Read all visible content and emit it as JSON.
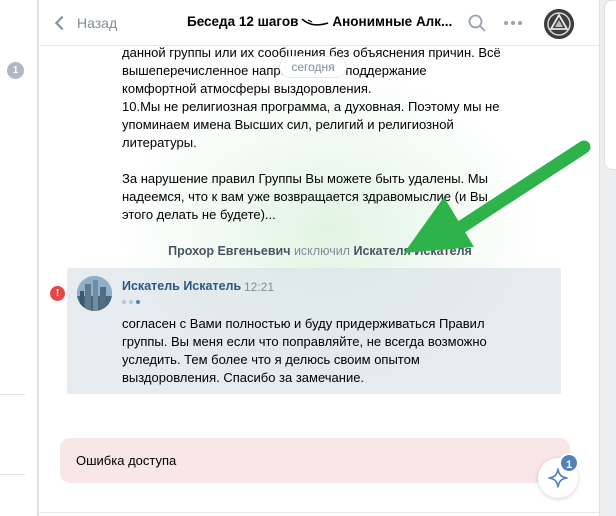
{
  "left": {
    "badge": "1"
  },
  "header": {
    "back_label": "Назад",
    "title_part1": "Беседа 12 шагов",
    "title_part2": "Анонимные Алк..."
  },
  "date_pill": "сегодня",
  "prev_message_lines": [
    "данной группы или их сообщения без объяснения причин. Всё",
    "вышеперечисленное направлено на поддержание",
    "комфортной атмосферы выздоровления.",
    "10.Мы не религиозная программа, а духовная. Поэтому мы не",
    "упоминаем имена Высших сил, религий и религиозной",
    "литературы.",
    "За нарушение правил Группы Вы можете быть удалены. Мы",
    "надеемся, что к вам уже возвращается здравомыслие (и Вы",
    "этого делать не будете)..."
  ],
  "service": {
    "actor": "Прохор Евгеньевич",
    "action": "исключил",
    "target": "Искателя Искателя"
  },
  "message": {
    "error_icon": "!",
    "author": "Искатель Искатель",
    "time": "12:21",
    "lines": [
      "согласен с Вами полностью и буду придерживаться Правил",
      "группы. Вы меня если что поправляйте, не всегда возможно",
      "уследить. Тем более что я делюсь своим опытом",
      "выздоровления. Спасибо за замечание."
    ]
  },
  "error_bar": "Ошибка доступа",
  "fab": {
    "icon": "sparkle-icon",
    "badge": "1"
  },
  "colors": {
    "link": "#2a5885",
    "error": "#e64646",
    "arrow": "#2db34a",
    "error_bg": "#f9e6e6"
  }
}
